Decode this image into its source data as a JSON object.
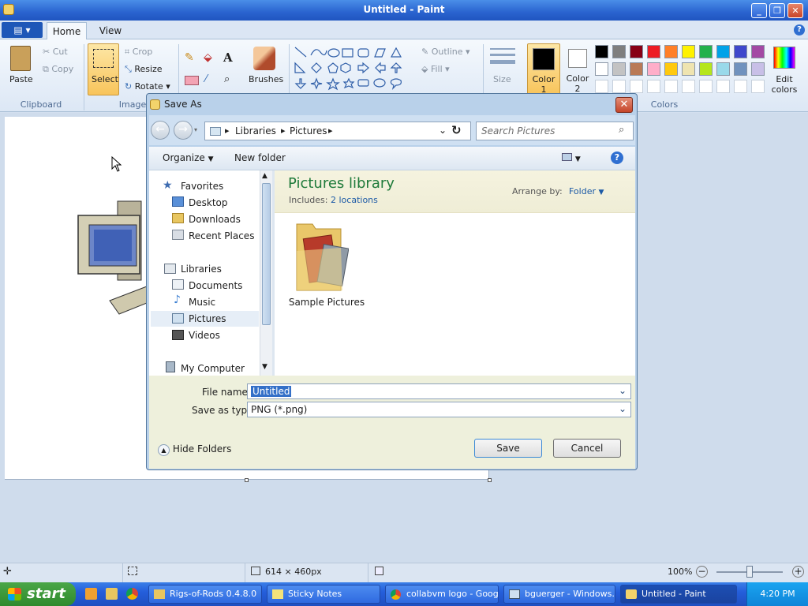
{
  "window": {
    "title": "Untitled - Paint"
  },
  "ribbon": {
    "tabs": [
      "Home",
      "View"
    ],
    "clipboard": {
      "paste": "Paste",
      "cut": "Cut",
      "copy": "Copy",
      "label": "Clipboard"
    },
    "image": {
      "select": "Select",
      "crop": "Crop",
      "resize": "Resize",
      "rotate": "Rotate",
      "label": "Image"
    },
    "tools": {
      "brushes": "Brushes"
    },
    "shapes": {
      "outline": "Outline",
      "fill": "Fill"
    },
    "size": "Size",
    "color1": "Color 1",
    "color2": "Color 2",
    "colors": {
      "row1": [
        "#000000",
        "#7f7f7f",
        "#880015",
        "#ed1c24",
        "#ff7f27",
        "#fff200",
        "#22b14c",
        "#00a2e8",
        "#3f48cc",
        "#a349a4"
      ],
      "row2": [
        "#ffffff",
        "#c3c3c3",
        "#b97a57",
        "#ffaec9",
        "#ffc90e",
        "#efe4b0",
        "#b5e61d",
        "#99d9ea",
        "#7092be",
        "#c8bfe7"
      ],
      "label": "Colors",
      "edit": "Edit colors"
    }
  },
  "dialog": {
    "title": "Save As",
    "breadcrumb": [
      "Libraries",
      "Pictures"
    ],
    "search_placeholder": "Search Pictures",
    "organize": "Organize",
    "new_folder": "New folder",
    "nav": {
      "favorites": "Favorites",
      "favorites_items": [
        "Desktop",
        "Downloads",
        "Recent Places"
      ],
      "libraries": "Libraries",
      "library_items": [
        "Documents",
        "Music",
        "Pictures",
        "Videos"
      ],
      "computer": "My Computer"
    },
    "library_title": "Pictures library",
    "includes_label": "Includes:",
    "includes_link": "2 locations",
    "arrange_label": "Arrange by:",
    "arrange_value": "Folder",
    "folder_name": "Sample Pictures",
    "file_name_label": "File name:",
    "file_name": "Untitled",
    "save_type_label": "Save as type:",
    "save_type": "PNG (*.png)",
    "hide_folders": "Hide Folders",
    "save": "Save",
    "cancel": "Cancel"
  },
  "statusbar": {
    "dimensions": "614 × 460px",
    "zoom": "100%"
  },
  "taskbar": {
    "start": "start",
    "items": [
      "Rigs-of-Rods 0.4.8.0",
      "Sticky Notes",
      "collabvm logo - Goog...",
      "bguerger - Windows...",
      "Untitled - Paint"
    ],
    "clock": "4:20 PM"
  }
}
